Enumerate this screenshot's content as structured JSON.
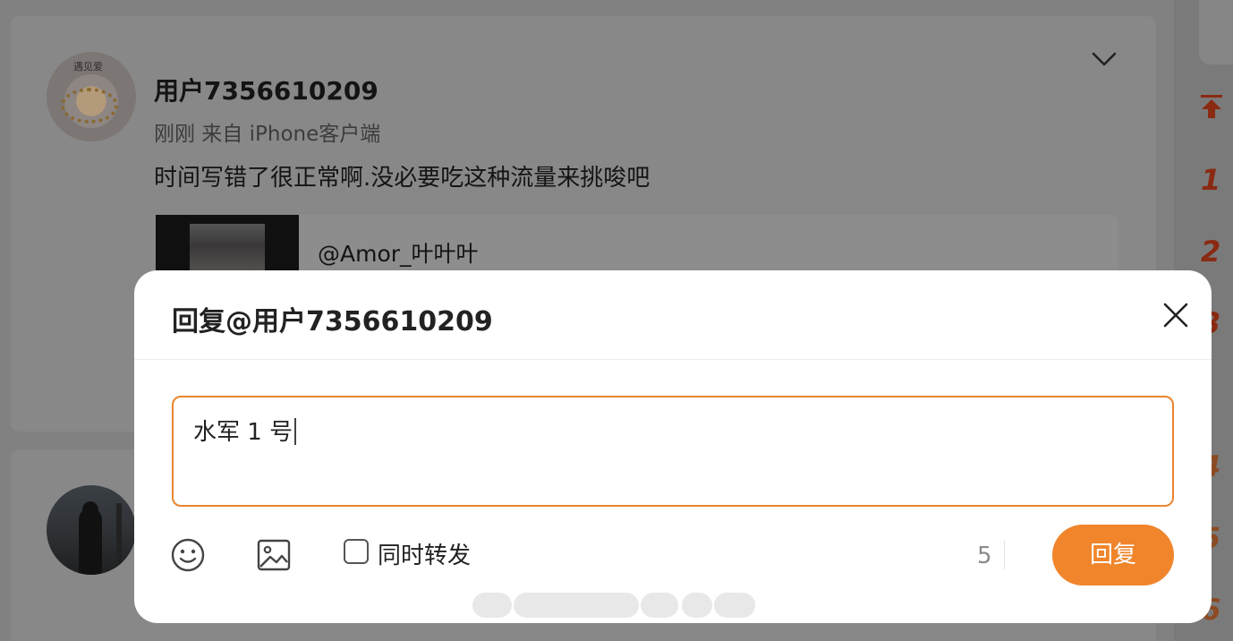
{
  "post": {
    "username": "用户7356610209",
    "meta": "刚刚  来自 iPhone客户端",
    "text": "时间写错了很正常啊.没必要吃这种流量来挑唆吧",
    "quoted_user": "@Amor_叶叶叶"
  },
  "rail": {
    "numbers": [
      "1",
      "2",
      "3",
      "4",
      "5",
      "6"
    ]
  },
  "dialog": {
    "title": "回复@用户7356610209",
    "input_value": "水军 1 号",
    "repost_label": "同时转发",
    "char_count": "5",
    "reply_button": "回复"
  },
  "icons": {
    "close": "close-icon",
    "emoji": "emoji-icon",
    "image": "image-icon",
    "back_to_top": "arrow-up-to-top-icon",
    "expand": "chevron-down-icon"
  },
  "colors": {
    "accent": "#f0852c",
    "input_border": "#e8852e",
    "rail_numbers": "#8a2a12"
  }
}
